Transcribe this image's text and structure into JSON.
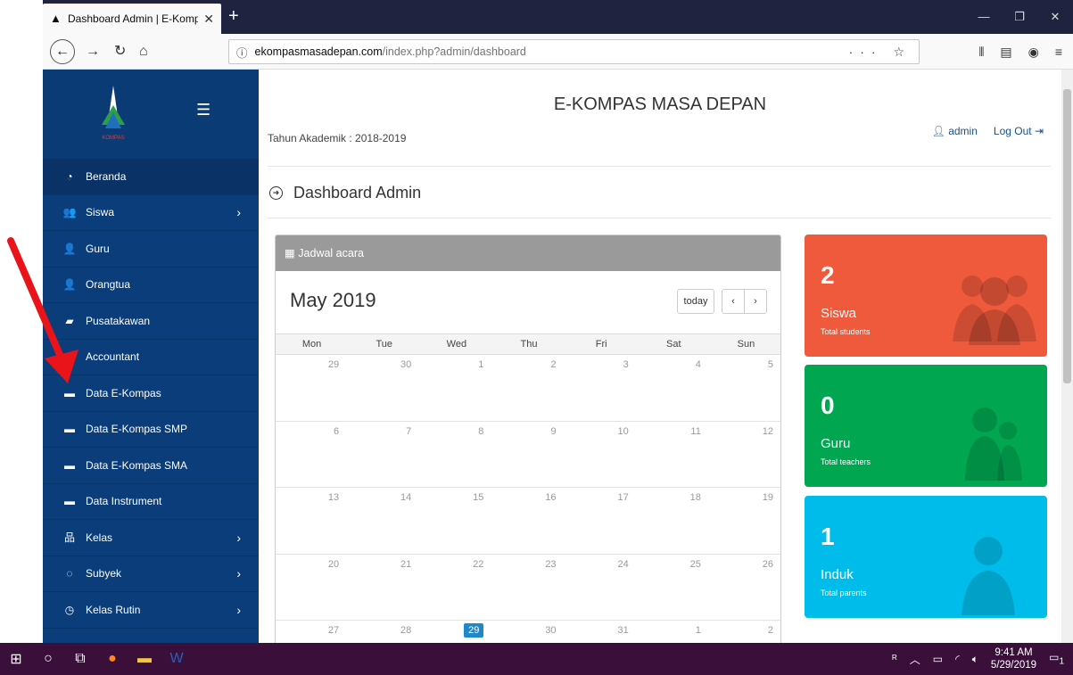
{
  "browser": {
    "tab_title": "Dashboard Admin | E-Kompas",
    "url_host": "ekompasmasadepan.com",
    "url_path": "/index.php?admin/dashboard",
    "url_tools": "··· ☆"
  },
  "app": {
    "site_title": "E-KOMPAS MASA DEPAN",
    "logo_text": "KOMPAS",
    "academic_year": "Tahun Akademik : 2018-2019",
    "user_name": "admin",
    "logout_label": "Log Out",
    "page_title": "Dashboard Admin"
  },
  "sidebar": {
    "items": [
      {
        "label": "Beranda",
        "icon": "dashboard-icon",
        "glyph": "◔",
        "chevron": false,
        "active": true
      },
      {
        "label": "Siswa",
        "icon": "users-icon",
        "glyph": "👥",
        "chevron": true
      },
      {
        "label": "Guru",
        "icon": "teacher-icon",
        "glyph": "👤",
        "chevron": false
      },
      {
        "label": "Orangtua",
        "icon": "user-icon",
        "glyph": "👤",
        "chevron": false
      },
      {
        "label": "Pusatakawan",
        "icon": "book-icon",
        "glyph": "▰",
        "chevron": false
      },
      {
        "label": "Accountant",
        "icon": "briefcase-icon",
        "glyph": "▬",
        "chevron": false
      },
      {
        "label": "Data E-Kompas",
        "icon": "briefcase-icon",
        "glyph": "▬",
        "chevron": false
      },
      {
        "label": "Data E-Kompas SMP",
        "icon": "briefcase-icon",
        "glyph": "▬",
        "chevron": false
      },
      {
        "label": "Data E-Kompas SMA",
        "icon": "briefcase-icon",
        "glyph": "▬",
        "chevron": false
      },
      {
        "label": "Data Instrument",
        "icon": "briefcase-icon",
        "glyph": "▬",
        "chevron": false
      },
      {
        "label": "Kelas",
        "icon": "sitemap-icon",
        "glyph": "品",
        "chevron": true
      },
      {
        "label": "Subyek",
        "icon": "subject-icon",
        "glyph": "◌",
        "chevron": true
      },
      {
        "label": "Kelas Rutin",
        "icon": "clock-icon",
        "glyph": "◷",
        "chevron": true
      }
    ]
  },
  "calendar": {
    "panel_title": "Jadwal acara",
    "month_title": "May 2019",
    "today_label": "today",
    "prev_label": "‹",
    "next_label": "›",
    "days": [
      "Mon",
      "Tue",
      "Wed",
      "Thu",
      "Fri",
      "Sat",
      "Sun"
    ],
    "weeks": [
      [
        "29",
        "30",
        "1",
        "2",
        "3",
        "4",
        "5"
      ],
      [
        "6",
        "7",
        "8",
        "9",
        "10",
        "11",
        "12"
      ],
      [
        "13",
        "14",
        "15",
        "16",
        "17",
        "18",
        "19"
      ],
      [
        "20",
        "21",
        "22",
        "23",
        "24",
        "25",
        "26"
      ],
      [
        "27",
        "28",
        "29",
        "30",
        "31",
        "1",
        "2"
      ]
    ],
    "today_date": "29"
  },
  "stats": [
    {
      "value": "2",
      "label": "Siswa",
      "sub": "Total students",
      "color": "#f05a3c",
      "icon": "users-icon"
    },
    {
      "value": "0",
      "label": "Guru",
      "sub": "Total teachers",
      "color": "#00a650",
      "icon": "teachers-icon"
    },
    {
      "value": "1",
      "label": "Induk",
      "sub": "Total parents",
      "color": "#00bcea",
      "icon": "parent-icon"
    }
  ],
  "taskbar": {
    "time": "9:41 AM",
    "date": "5/29/2019",
    "notification_count": "1"
  },
  "colors": {
    "sidebar": "#0a3d7a",
    "arrow": "#e8141a"
  }
}
